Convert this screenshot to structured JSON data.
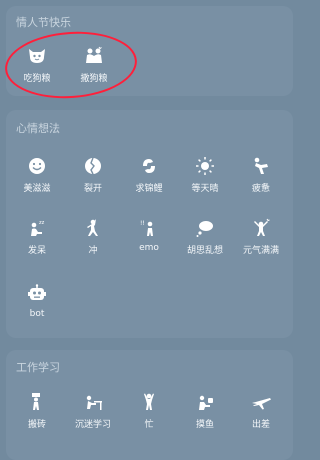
{
  "sections": [
    {
      "title": "情人节快乐",
      "items": [
        {
          "label": "吃狗粮",
          "icon": "dog-face-icon"
        },
        {
          "label": "撒狗粮",
          "icon": "couple-hug-icon"
        }
      ]
    },
    {
      "title": "心情想法",
      "items": [
        {
          "label": "美滋滋",
          "icon": "smile-face-icon"
        },
        {
          "label": "裂开",
          "icon": "cracked-heart-icon"
        },
        {
          "label": "求锦鲤",
          "icon": "koi-fish-icon"
        },
        {
          "label": "等天晴",
          "icon": "sun-icon"
        },
        {
          "label": "疲惫",
          "icon": "tired-person-icon"
        },
        {
          "label": "发呆",
          "icon": "daze-person-icon"
        },
        {
          "label": "冲",
          "icon": "charge-person-icon"
        },
        {
          "label": "emo",
          "icon": "emo-person-icon"
        },
        {
          "label": "胡思乱想",
          "icon": "thought-bubble-icon"
        },
        {
          "label": "元气满满",
          "icon": "energetic-person-icon"
        },
        {
          "label": "bot",
          "icon": "robot-icon"
        }
      ]
    },
    {
      "title": "工作学习",
      "items": [
        {
          "label": "搬砖",
          "icon": "carry-brick-icon"
        },
        {
          "label": "沉迷学习",
          "icon": "study-desk-icon"
        },
        {
          "label": "忙",
          "icon": "busy-person-icon"
        },
        {
          "label": "摸鱼",
          "icon": "slacking-person-icon"
        },
        {
          "label": "出差",
          "icon": "airplane-icon"
        }
      ]
    }
  ],
  "annotation": {
    "color": "#ff1f3a"
  }
}
